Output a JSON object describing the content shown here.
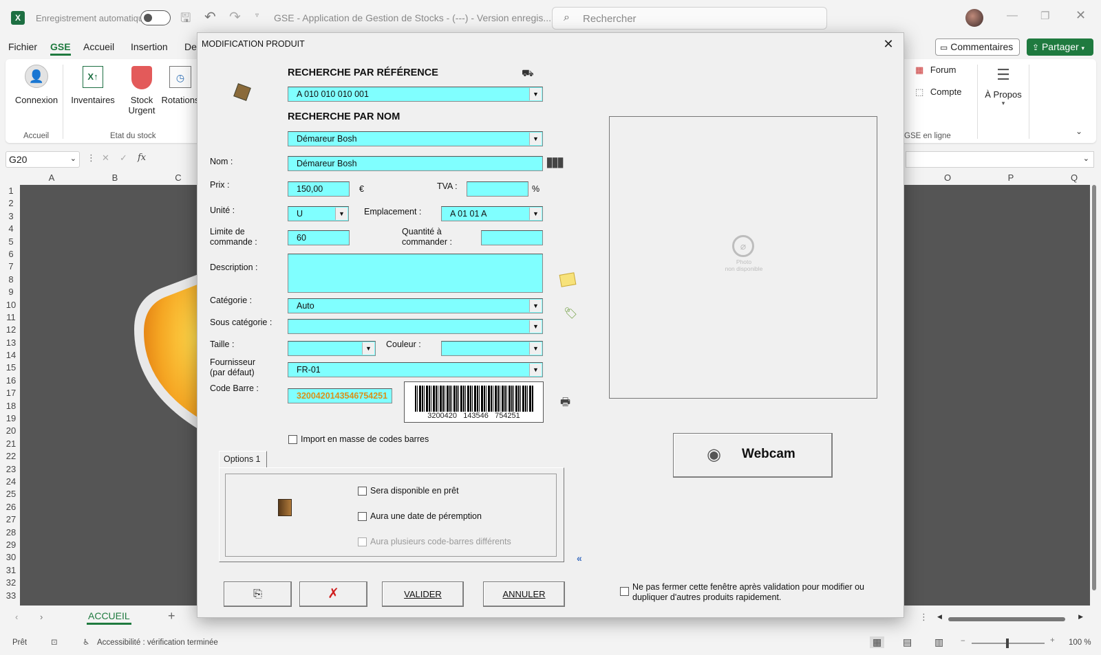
{
  "titlebar": {
    "autosave_label": "Enregistrement automatique",
    "doc_title": "GSE - Application de Gestion de Stocks - (---) - Version enregis...",
    "search_placeholder": "Rechercher"
  },
  "menu": {
    "items": [
      "Fichier",
      "GSE",
      "Accueil",
      "Insertion",
      "De"
    ],
    "comments_label": "Commentaires",
    "share_label": "Partager"
  },
  "ribbon": {
    "connexion": "Connexion",
    "inventaires": "Inventaires",
    "stock_urgent_1": "Stock",
    "stock_urgent_2": "Urgent",
    "rotations": "Rotations",
    "group_accueil": "Accueil",
    "group_etat": "Etat du stock",
    "forum": "Forum",
    "compte": "Compte",
    "apropos": "À Propos",
    "group_enligne": "GSE en ligne"
  },
  "formula_bar": {
    "cell_ref": "G20",
    "fx": "fx"
  },
  "grid": {
    "left_columns": [
      "A",
      "B",
      "C"
    ],
    "right_columns": [
      "O",
      "P",
      "Q"
    ],
    "rows": [
      "1",
      "2",
      "3",
      "4",
      "5",
      "6",
      "7",
      "8",
      "9",
      "10",
      "11",
      "12",
      "13",
      "14",
      "15",
      "16",
      "17",
      "18",
      "19",
      "20",
      "21",
      "22",
      "23",
      "24",
      "25",
      "26",
      "27",
      "28",
      "29",
      "30",
      "31",
      "32",
      "33"
    ]
  },
  "sheets": {
    "active": "ACCUEIL"
  },
  "status": {
    "ready": "Prêt",
    "accessibility": "Accessibilité : vérification terminée",
    "zoom": "100 %"
  },
  "dialog": {
    "title": "MODIFICATION PRODUIT",
    "search_ref_header": "RECHERCHE PAR RÉFÉRENCE",
    "search_ref_value": "A 010 010 010 001",
    "search_name_header": "RECHERCHE PAR NOM",
    "search_name_value": "Démareur Bosh",
    "labels": {
      "nom": "Nom :",
      "prix": "Prix :",
      "tva": "TVA :",
      "unite": "Unité :",
      "emplacement": "Emplacement :",
      "limite_1": "Limite de",
      "limite_2": "commande :",
      "qte_1": "Quantité à",
      "qte_2": "commander :",
      "description": "Description :",
      "categorie": "Catégorie :",
      "sous_categorie": "Sous catégorie :",
      "taille": "Taille :",
      "couleur": "Couleur :",
      "fournisseur_1": "Fournisseur",
      "fournisseur_2": "(par défaut)",
      "code_barre": "Code Barre :",
      "euro": "€",
      "percent": "%"
    },
    "values": {
      "nom": "Démareur Bosh",
      "prix": "150,00",
      "tva": "",
      "unite": "U",
      "emplacement": "A 01 01 A",
      "limite": "60",
      "qte": "",
      "description": "",
      "categorie": "Auto",
      "sous_categorie": "",
      "taille": "",
      "couleur": "",
      "fournisseur": "FR-01",
      "code_barre": "3200420143546754251",
      "barcode_text": "3200420   143546   754251"
    },
    "import_mass": "Import en masse de codes barres",
    "tab_options": "Options 1",
    "options": {
      "pret": "Sera disponible en prêt",
      "peremption": "Aura une date de péremption",
      "multi_barcodes": "Aura plusieurs code-barres différents"
    },
    "photo_text_1": "Photo",
    "photo_text_2": "non disponible",
    "webcam_label": "Webcam",
    "valider_label": "VALIDER",
    "annuler_label": "ANNULER",
    "keep_open_text_1": "Ne pas fermer cette fenêtre après validation pour modifier ou",
    "keep_open_text_2": "dupliquer d'autres produits rapidement."
  },
  "colors": {
    "field": "#80ffff",
    "accent_green": "#1f7a3f",
    "barcode_orange": "#d9901a"
  }
}
